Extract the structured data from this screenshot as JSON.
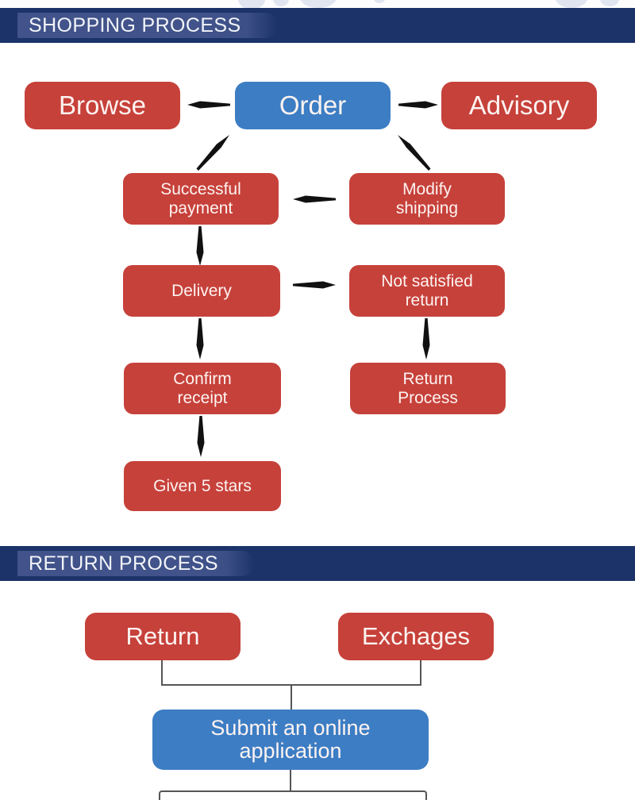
{
  "document": {
    "title": "Shopping Process / Return Process flowchart"
  },
  "sections": [
    {
      "id": "shopping",
      "heading": "SHOPPING PROCESS"
    },
    {
      "id": "return",
      "heading": "RETURN PROCESS"
    }
  ],
  "colors": {
    "header_bar": "#1b3368",
    "ribbon": "#41538a",
    "box_red": "#c6413a",
    "box_blue": "#3c7dc4",
    "box_text": "#fdf3f1",
    "connector": "#111111",
    "bracket": "#555555",
    "page_background": "#ffffff"
  },
  "shopping_process": {
    "nodes": [
      {
        "id": "browse",
        "label": "Browse",
        "color": "red",
        "size": "large"
      },
      {
        "id": "order",
        "label": "Order",
        "color": "blue",
        "size": "large"
      },
      {
        "id": "advisory",
        "label": "Advisory",
        "color": "red",
        "size": "large"
      },
      {
        "id": "successful-payment",
        "label": "Successful\npayment",
        "color": "red",
        "size": "small"
      },
      {
        "id": "modify-shipping",
        "label": "Modify\nshipping",
        "color": "red",
        "size": "small"
      },
      {
        "id": "delivery",
        "label": "Delivery",
        "color": "red",
        "size": "small"
      },
      {
        "id": "not-satisfied-return",
        "label": "Not satisfied\nreturn",
        "color": "red",
        "size": "small"
      },
      {
        "id": "confirm-receipt",
        "label": "Confirm\nreceipt",
        "color": "red",
        "size": "small"
      },
      {
        "id": "return-process-box",
        "label": "Return\nProcess",
        "color": "red",
        "size": "small"
      },
      {
        "id": "given-5-stars",
        "label": "Given 5 stars",
        "color": "red",
        "size": "small"
      }
    ],
    "labels": {
      "browse": "Browse",
      "order": "Order",
      "advisory": "Advisory",
      "successful_payment_line1": "Successful",
      "successful_payment_line2": "payment",
      "modify_shipping_line1": "Modify",
      "modify_shipping_line2": "shipping",
      "delivery": "Delivery",
      "not_satisfied_line1": "Not satisfied",
      "not_satisfied_line2": "return",
      "confirm_receipt_line1": "Confirm",
      "confirm_receipt_line2": "receipt",
      "return_process_line1": "Return",
      "return_process_line2": "Process",
      "given_5_stars": "Given 5 stars"
    },
    "edges": [
      {
        "from": "order",
        "to": "browse",
        "direction": "left",
        "style": "straight-arrow"
      },
      {
        "from": "order",
        "to": "advisory",
        "direction": "right",
        "style": "straight-arrow"
      },
      {
        "from": "successful-payment",
        "to": "order",
        "direction": "up-right",
        "style": "diagonal-arrow"
      },
      {
        "from": "order",
        "to": "modify-shipping",
        "direction": "down-right",
        "style": "diagonal-arrow"
      },
      {
        "from": "modify-shipping",
        "to": "successful-payment",
        "direction": "left",
        "style": "straight-arrow"
      },
      {
        "from": "successful-payment",
        "to": "delivery",
        "direction": "down",
        "style": "straight-arrow"
      },
      {
        "from": "delivery",
        "to": "not-satisfied-return",
        "direction": "right",
        "style": "straight-arrow"
      },
      {
        "from": "delivery",
        "to": "confirm-receipt",
        "direction": "down",
        "style": "straight-arrow"
      },
      {
        "from": "not-satisfied-return",
        "to": "return-process-box",
        "direction": "down",
        "style": "straight-arrow"
      },
      {
        "from": "confirm-receipt",
        "to": "given-5-stars",
        "direction": "down",
        "style": "straight-arrow"
      }
    ]
  },
  "return_process": {
    "nodes": [
      {
        "id": "return",
        "label": "Return",
        "color": "red",
        "size": "large"
      },
      {
        "id": "exchages",
        "label": "Exchages",
        "color": "red",
        "size": "large"
      },
      {
        "id": "submit-online-application",
        "label": "Submit an online\napplication",
        "color": "blue",
        "size": "large"
      },
      {
        "id": "next-step-cut-off",
        "label": "",
        "color": "outline",
        "size": "large"
      }
    ],
    "labels": {
      "return": "Return",
      "exchages": "Exchages",
      "submit_line1": "Submit an online",
      "submit_line2": "application"
    },
    "edges": [
      {
        "from": "return",
        "to": "submit-online-application",
        "style": "bracket-merge"
      },
      {
        "from": "exchages",
        "to": "submit-online-application",
        "style": "bracket-merge"
      },
      {
        "from": "submit-online-application",
        "to": "next-step-cut-off",
        "style": "bracket-split"
      }
    ]
  }
}
